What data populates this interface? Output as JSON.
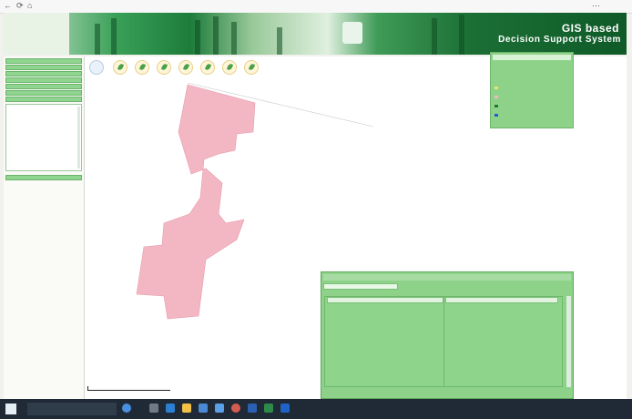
{
  "browser": {
    "back_icon": "back-arrow-icon",
    "refresh_icon": "refresh-icon",
    "home_icon": "home-icon",
    "address": "",
    "menu_icon": "more-icon"
  },
  "header": {
    "title_line1": "GIS based",
    "title_line2": "Decision Support System",
    "colors": {
      "banner_dark": "#0f5a28",
      "banner_light": "#dff0df"
    }
  },
  "sidebar": {
    "items": [
      {
        "label": ""
      },
      {
        "label": ""
      },
      {
        "label": ""
      },
      {
        "label": ""
      },
      {
        "label": ""
      },
      {
        "label": ""
      },
      {
        "label": ""
      }
    ],
    "sub_items": [
      {
        "label": ""
      },
      {
        "label": ""
      },
      {
        "label": ""
      },
      {
        "label": ""
      },
      {
        "label": ""
      },
      {
        "label": ""
      },
      {
        "label": ""
      }
    ],
    "bottom_item": {
      "label": ""
    }
  },
  "map": {
    "tools": [
      "globe-icon",
      "leaf-tool-icon",
      "leaf-tool-icon",
      "leaf-tool-icon",
      "leaf-tool-icon",
      "leaf-tool-icon",
      "leaf-tool-icon",
      "leaf-tool-icon"
    ],
    "polygon_color": "#f3b7c4",
    "info_text": "",
    "scale_text": ""
  },
  "layer_panel": {
    "header": "",
    "rows": [
      {
        "label": "",
        "color": "#8ed28a"
      },
      {
        "label": "",
        "color": "#8ed28a"
      },
      {
        "label": "",
        "color": "#8ed28a"
      },
      {
        "label": "",
        "color": "#e8e36e"
      },
      {
        "label": "",
        "color": "#f3b7c4"
      },
      {
        "label": "",
        "color": "#1f7a2f"
      },
      {
        "label": "",
        "color": "#1f5fd0"
      }
    ]
  },
  "attribute_panel": {
    "title": "",
    "field": "",
    "columns": [
      "",
      ""
    ],
    "row": [
      "",
      ""
    ],
    "footer": ""
  },
  "scalebar": {
    "label": "",
    "max": ""
  },
  "taskbar": {
    "search_placeholder": "",
    "icons": [
      "search-icon",
      "task-view-icon",
      "edge-icon",
      "folder-icon",
      "store-icon",
      "mail-icon",
      "chrome-icon",
      "word-icon",
      "excel-icon",
      "outlook-icon"
    ]
  }
}
